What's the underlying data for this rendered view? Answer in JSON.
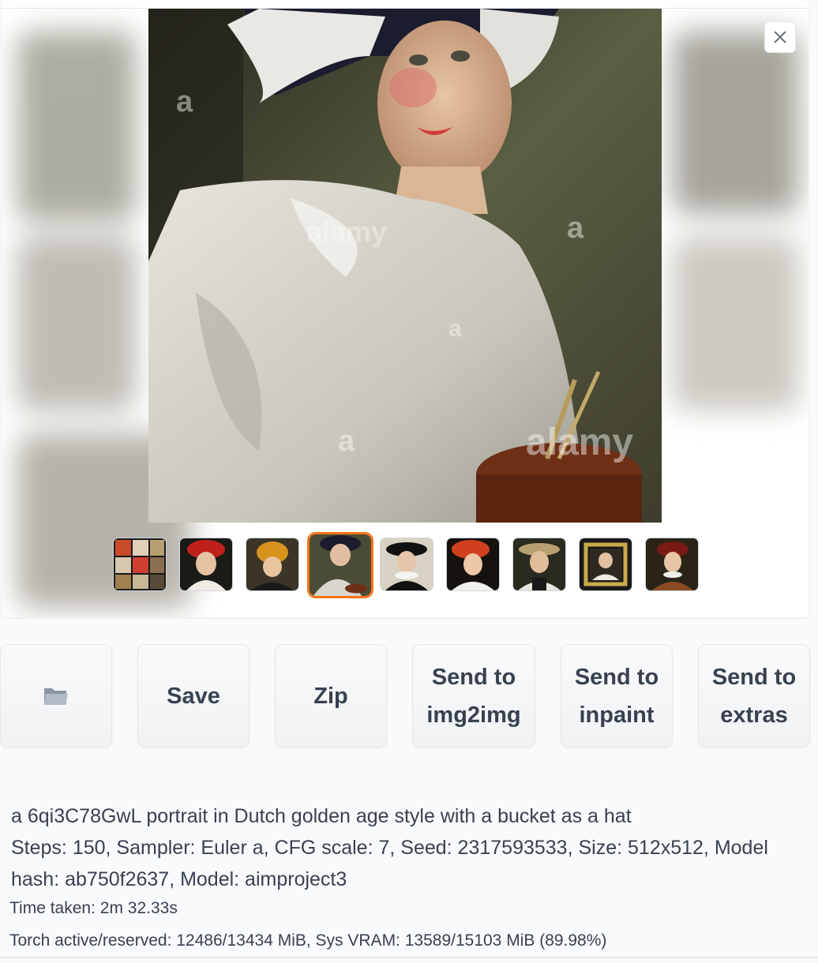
{
  "gallery": {
    "close_icon": "close-icon",
    "selected_index": 3,
    "thumbnail_count": 9
  },
  "buttons": {
    "folder_icon": "folder-icon",
    "save": "Save",
    "zip": "Zip",
    "send_img2img_line1": "Send to",
    "send_img2img_line2": "img2img",
    "send_inpaint_line1": "Send to",
    "send_inpaint_line2": "inpaint",
    "send_extras_line1": "Send to",
    "send_extras_line2": "extras"
  },
  "info": {
    "prompt": "a 6qi3C78GwL portrait in Dutch golden age style with a bucket as a hat",
    "params_line1": "Steps: 150, Sampler: Euler a, CFG scale: 7, Seed: 2317593533, Size: 512x512, Model",
    "params_line2": "hash: ab750f2637, Model: aimproject3",
    "time_taken": "Time taken: 2m 32.33s",
    "torch_stats": "Torch active/reserved: 12486/13434 MiB, Sys VRAM: 13589/15103 MiB (89.98%)"
  },
  "colors": {
    "accent": "#f97316",
    "background": "#f9fafb"
  }
}
